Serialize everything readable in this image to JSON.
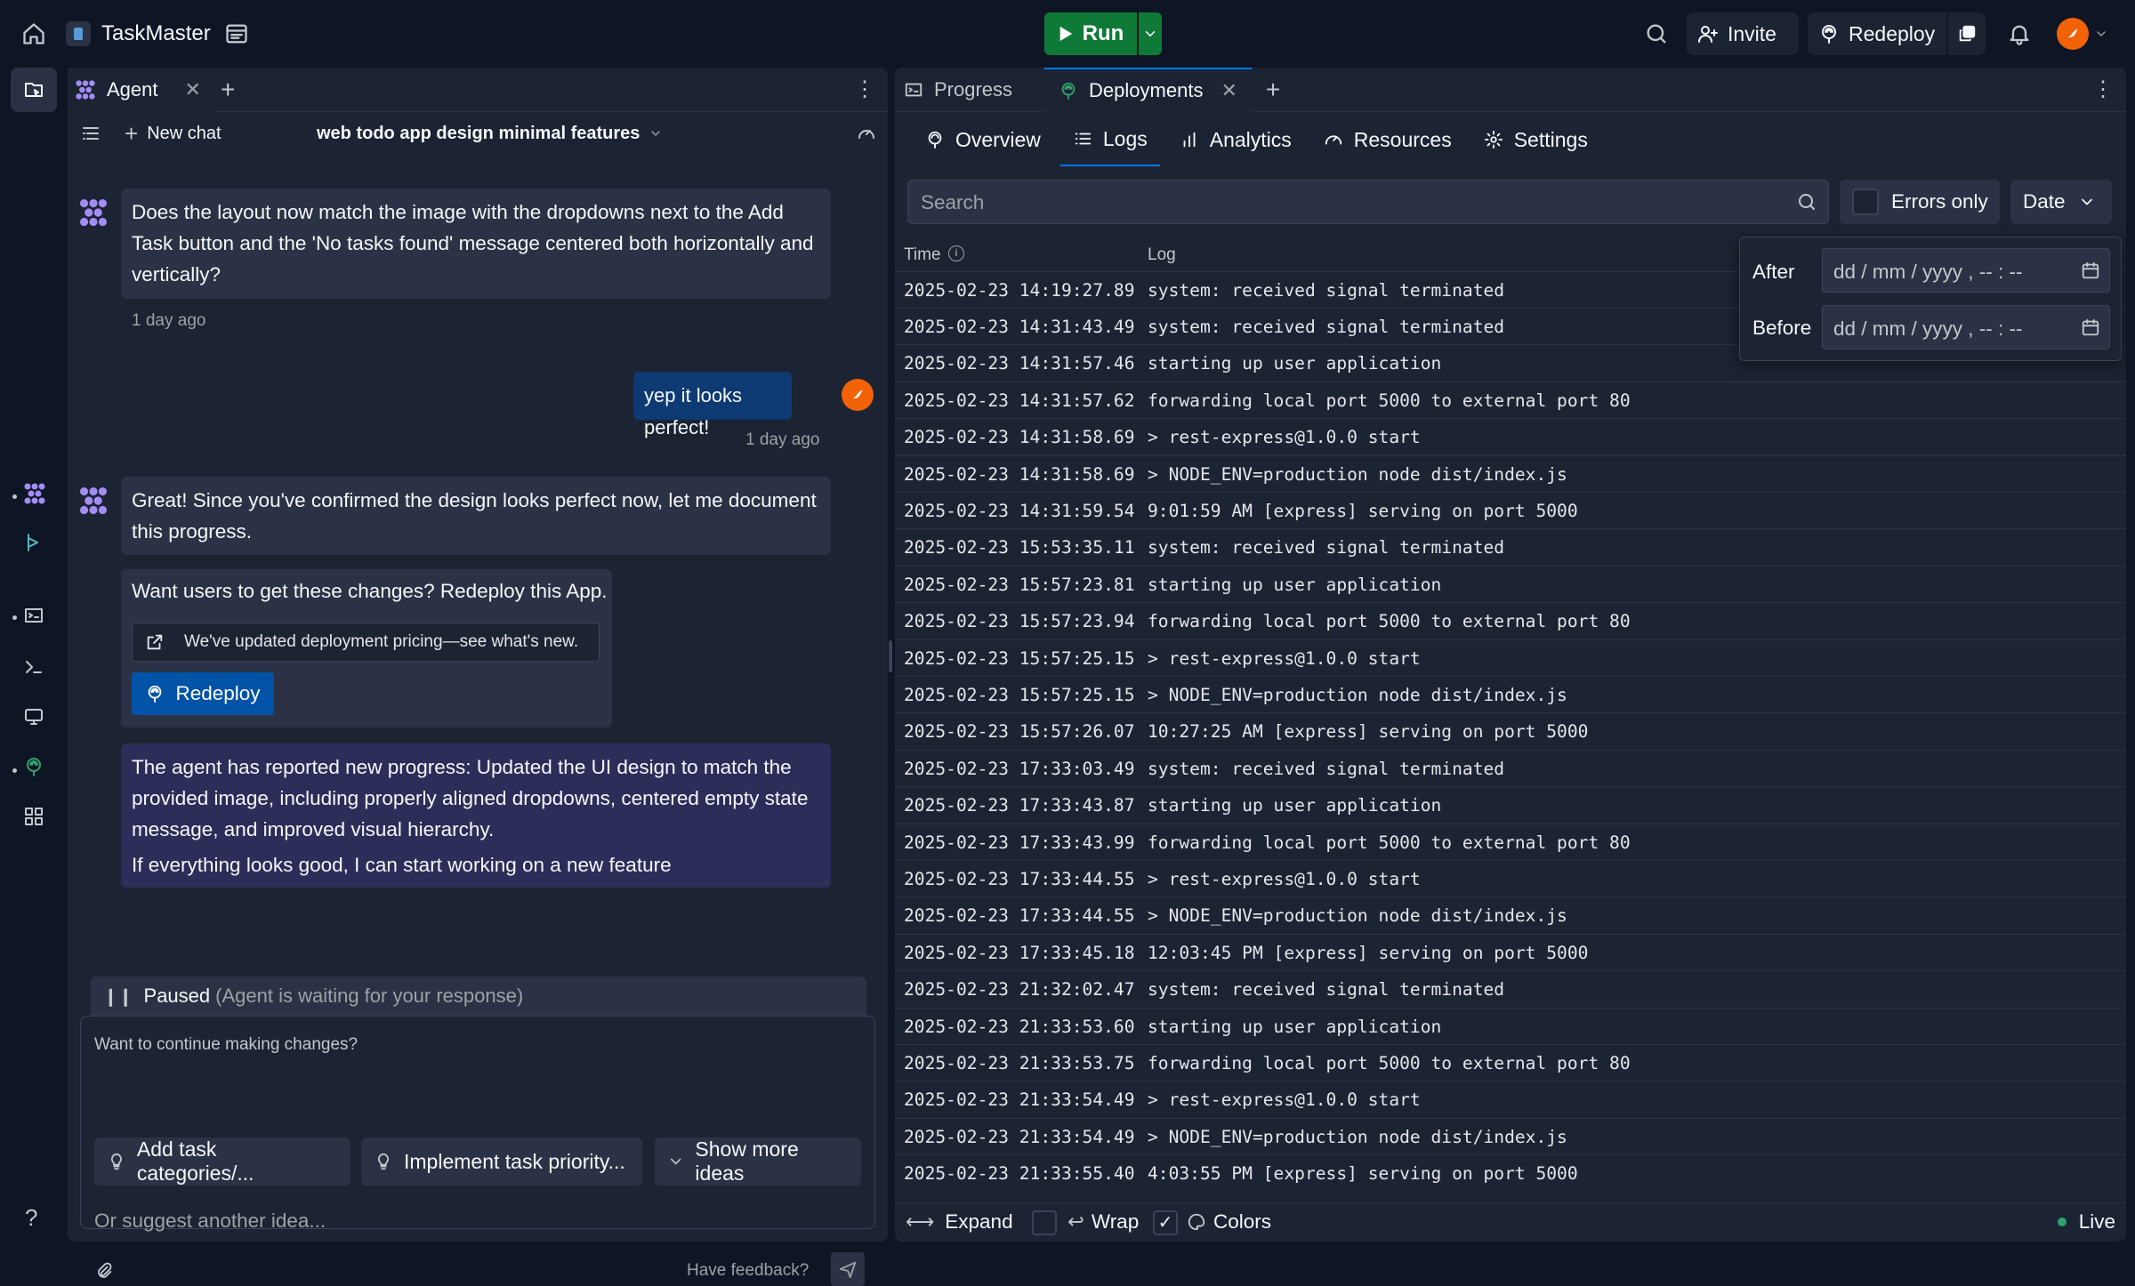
{
  "topbar": {
    "project_name": "TaskMaster",
    "run_label": "Run",
    "invite_label": "Invite",
    "redeploy_label": "Redeploy"
  },
  "agent_panel": {
    "tab_label": "Agent",
    "new_chat_label": "New chat",
    "chat_title": "web todo app design minimal features",
    "messages": [
      {
        "text": "Does the layout now match the image with the dropdowns next to the Add Task button and the 'No tasks found' message centered both horizontally and vertically?",
        "time": "1 day ago"
      },
      {
        "text": "yep it looks perfect!",
        "time": "1 day ago"
      },
      {
        "text": "Great! Since you've confirmed the design looks perfect now, let me document this progress."
      }
    ],
    "redeploy_card": {
      "prompt": "Want users to get these changes? Redeploy this App.",
      "pricing_link": "We've updated deployment pricing—see what's new.",
      "button_label": "Redeploy"
    },
    "progress_message": {
      "text": "The agent has reported new progress: Updated the UI design to match the provided image, including properly aligned dropdowns, centered empty state message, and improved visual hierarchy.",
      "followup": "If everything looks good, I can start working on a new feature"
    },
    "status": {
      "label": "Paused",
      "detail": "(Agent is waiting for your response)"
    },
    "suggestions_heading": "Want to continue making changes?",
    "suggestions": [
      "Add task categories/...",
      "Implement task priority...",
      "Show more ideas"
    ],
    "input_placeholder": "Or suggest another idea...",
    "feedback_label": "Have feedback?"
  },
  "deploy_panel": {
    "tabs": [
      "Progress",
      "Deployments"
    ],
    "subtabs": [
      "Overview",
      "Logs",
      "Analytics",
      "Resources",
      "Settings"
    ],
    "search_placeholder": "Search",
    "errors_only_label": "Errors only",
    "date_label": "Date",
    "date_filter": {
      "after_label": "After",
      "before_label": "Before",
      "placeholder": "dd / mm / yyyy , -- : --"
    },
    "columns": {
      "time": "Time",
      "log": "Log"
    },
    "logs": [
      {
        "time": "2025-02-23 14:19:27.89",
        "msg": "system: received signal terminated"
      },
      {
        "time": "2025-02-23 14:31:43.49",
        "msg": "system: received signal terminated"
      },
      {
        "time": "2025-02-23 14:31:57.46",
        "msg": "starting up user application"
      },
      {
        "time": "2025-02-23 14:31:57.62",
        "msg": "forwarding local port 5000 to external port 80"
      },
      {
        "time": "2025-02-23 14:31:58.69",
        "msg": "> rest-express@1.0.0 start"
      },
      {
        "time": "2025-02-23 14:31:58.69",
        "msg": "> NODE_ENV=production node dist/index.js"
      },
      {
        "time": "2025-02-23 14:31:59.54",
        "msg": "9:01:59 AM [express] serving on port 5000"
      },
      {
        "time": "2025-02-23 15:53:35.11",
        "msg": "system: received signal terminated"
      },
      {
        "time": "2025-02-23 15:57:23.81",
        "msg": "starting up user application"
      },
      {
        "time": "2025-02-23 15:57:23.94",
        "msg": "forwarding local port 5000 to external port 80"
      },
      {
        "time": "2025-02-23 15:57:25.15",
        "msg": "> rest-express@1.0.0 start"
      },
      {
        "time": "2025-02-23 15:57:25.15",
        "msg": "> NODE_ENV=production node dist/index.js"
      },
      {
        "time": "2025-02-23 15:57:26.07",
        "msg": "10:27:25 AM [express] serving on port 5000"
      },
      {
        "time": "2025-02-23 17:33:03.49",
        "msg": "system: received signal terminated"
      },
      {
        "time": "2025-02-23 17:33:43.87",
        "msg": "starting up user application"
      },
      {
        "time": "2025-02-23 17:33:43.99",
        "msg": "forwarding local port 5000 to external port 80"
      },
      {
        "time": "2025-02-23 17:33:44.55",
        "msg": "> rest-express@1.0.0 start"
      },
      {
        "time": "2025-02-23 17:33:44.55",
        "msg": "> NODE_ENV=production node dist/index.js"
      },
      {
        "time": "2025-02-23 17:33:45.18",
        "msg": "12:03:45 PM [express] serving on port 5000"
      },
      {
        "time": "2025-02-23 21:32:02.47",
        "msg": "system: received signal terminated"
      },
      {
        "time": "2025-02-23 21:33:53.60",
        "msg": "starting up user application"
      },
      {
        "time": "2025-02-23 21:33:53.75",
        "msg": "forwarding local port 5000 to external port 80"
      },
      {
        "time": "2025-02-23 21:33:54.49",
        "msg": "> rest-express@1.0.0 start"
      },
      {
        "time": "2025-02-23 21:33:54.49",
        "msg": "> NODE_ENV=production node dist/index.js"
      },
      {
        "time": "2025-02-23 21:33:55.40",
        "msg": "4:03:55 PM [express] serving on port 5000"
      }
    ],
    "footer": {
      "expand": "Expand",
      "wrap": "Wrap",
      "colors": "Colors",
      "live": "Live"
    }
  },
  "colors": {
    "accent": "#0079f2",
    "run_green": "#0f7a38",
    "agent_purple": "#a48cf5",
    "progress_bubble": "#2d2d59"
  }
}
